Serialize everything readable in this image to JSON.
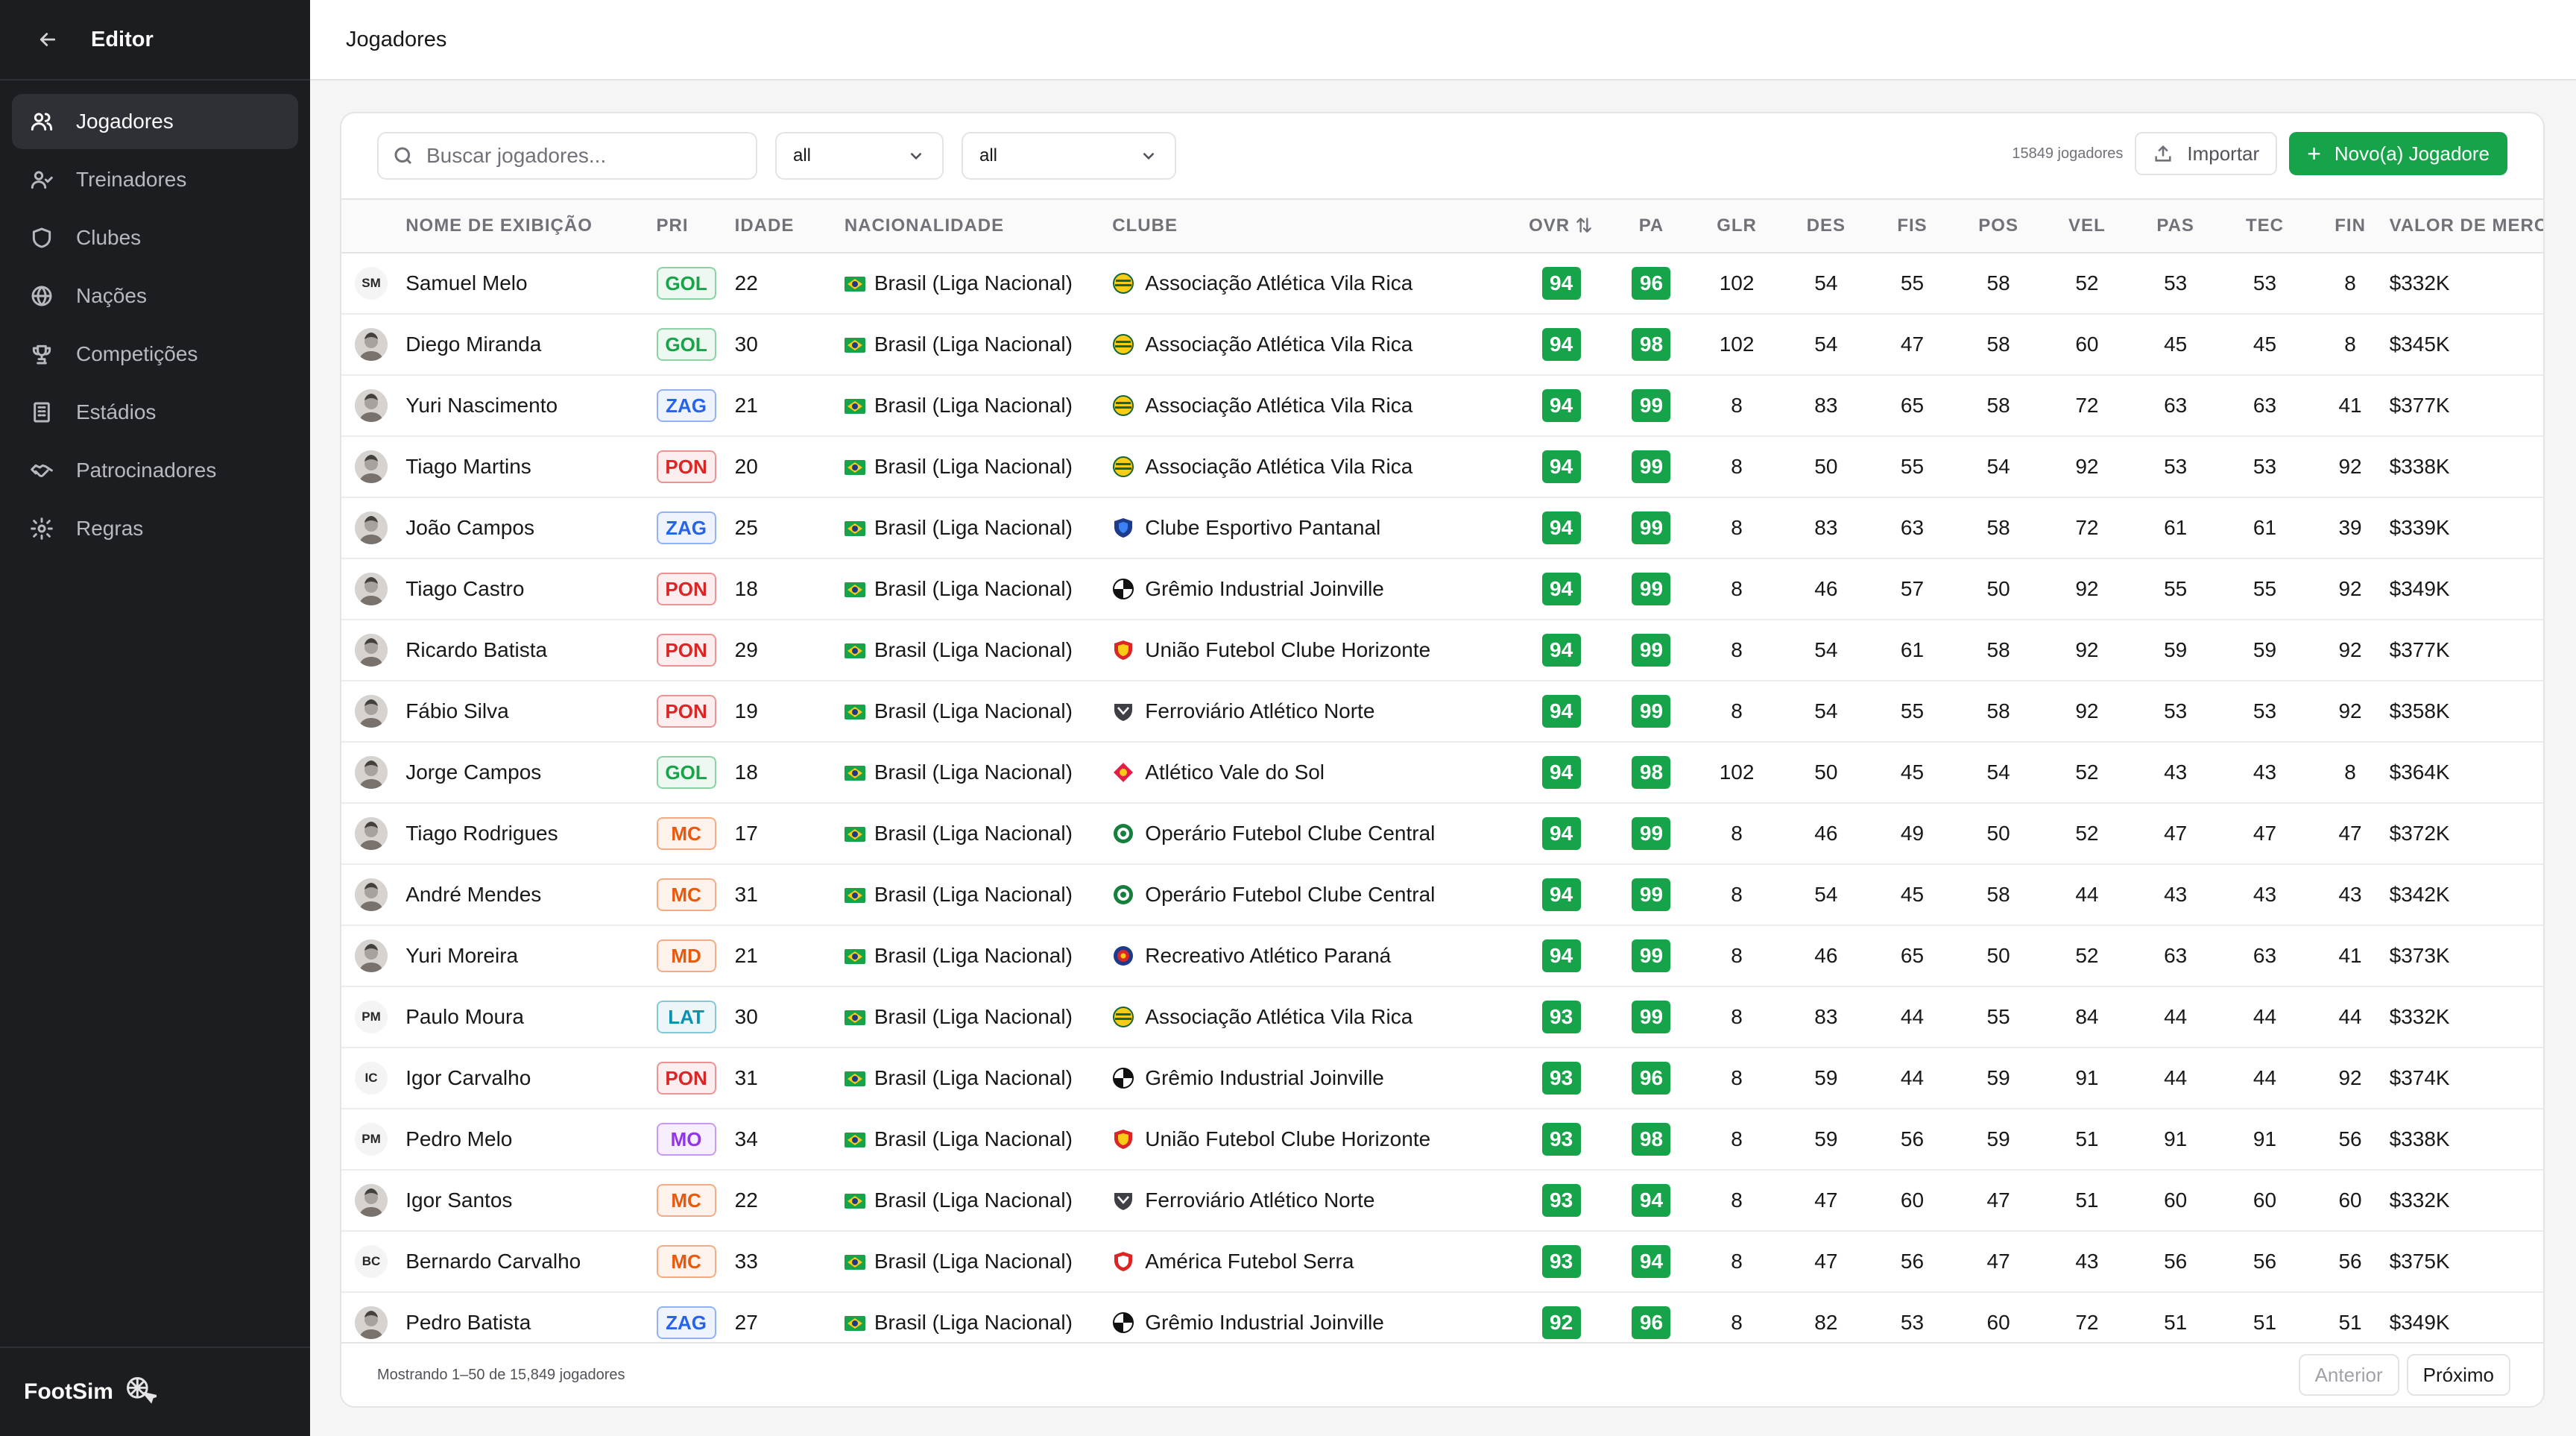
{
  "sidebar": {
    "title": "Editor",
    "nav": [
      {
        "label": "Jogadores",
        "icon": "users-icon",
        "active": true
      },
      {
        "label": "Treinadores",
        "icon": "user-coach-icon",
        "active": false
      },
      {
        "label": "Clubes",
        "icon": "shield-icon",
        "active": false
      },
      {
        "label": "Nações",
        "icon": "globe-icon",
        "active": false
      },
      {
        "label": "Competições",
        "icon": "trophy-icon",
        "active": false
      },
      {
        "label": "Estádios",
        "icon": "building-icon",
        "active": false
      },
      {
        "label": "Patrocinadores",
        "icon": "handshake-icon",
        "active": false
      },
      {
        "label": "Regras",
        "icon": "gear-icon",
        "active": false
      }
    ],
    "brand": "FootSim"
  },
  "header": {
    "title": "Jogadores"
  },
  "toolbar": {
    "search_placeholder": "Buscar jogadores...",
    "filter1": "all",
    "filter2": "all",
    "count": "15849 jogadores",
    "import_label": "Importar",
    "new_label": "Novo(a) Jogadore"
  },
  "table": {
    "columns": [
      "",
      "NOME DE EXIBIÇÃO",
      "PRI",
      "IDADE",
      "NACIONALIDADE",
      "CLUBE",
      "OVR",
      "PA",
      "GLR",
      "DES",
      "FIS",
      "POS",
      "VEL",
      "PAS",
      "TEC",
      "FIN",
      "VALOR DE MERCADO"
    ],
    "rows": [
      {
        "avatar": "SM",
        "photo": false,
        "name": "Samuel Melo",
        "pos": "GOL",
        "age": "22",
        "nat": "Brasil (Liga Nacional)",
        "club": "Associação Atlética Vila Rica",
        "crest": "stripes",
        "ovr": "94",
        "pa": "96",
        "glr": "102",
        "des": "54",
        "fis": "55",
        "posv": "58",
        "vel": "52",
        "pas": "53",
        "tec": "53",
        "fin": "8",
        "value": "$332K"
      },
      {
        "avatar": "",
        "photo": true,
        "name": "Diego Miranda",
        "pos": "GOL",
        "age": "30",
        "nat": "Brasil (Liga Nacional)",
        "club": "Associação Atlética Vila Rica",
        "crest": "stripes",
        "ovr": "94",
        "pa": "98",
        "glr": "102",
        "des": "54",
        "fis": "47",
        "posv": "58",
        "vel": "60",
        "pas": "45",
        "tec": "45",
        "fin": "8",
        "value": "$345K"
      },
      {
        "avatar": "",
        "photo": true,
        "name": "Yuri Nascimento",
        "pos": "ZAG",
        "age": "21",
        "nat": "Brasil (Liga Nacional)",
        "club": "Associação Atlética Vila Rica",
        "crest": "stripes",
        "ovr": "94",
        "pa": "99",
        "glr": "8",
        "des": "83",
        "fis": "65",
        "posv": "58",
        "vel": "72",
        "pas": "63",
        "tec": "63",
        "fin": "41",
        "value": "$377K"
      },
      {
        "avatar": "",
        "photo": true,
        "name": "Tiago Martins",
        "pos": "PON",
        "age": "20",
        "nat": "Brasil (Liga Nacional)",
        "club": "Associação Atlética Vila Rica",
        "crest": "stripes",
        "ovr": "94",
        "pa": "99",
        "glr": "8",
        "des": "50",
        "fis": "55",
        "posv": "54",
        "vel": "92",
        "pas": "53",
        "tec": "53",
        "fin": "92",
        "value": "$338K"
      },
      {
        "avatar": "",
        "photo": true,
        "name": "João Campos",
        "pos": "ZAG",
        "age": "25",
        "nat": "Brasil (Liga Nacional)",
        "club": "Clube Esportivo Pantanal",
        "crest": "blue",
        "ovr": "94",
        "pa": "99",
        "glr": "8",
        "des": "83",
        "fis": "63",
        "posv": "58",
        "vel": "72",
        "pas": "61",
        "tec": "61",
        "fin": "39",
        "value": "$339K"
      },
      {
        "avatar": "",
        "photo": true,
        "name": "Tiago Castro",
        "pos": "PON",
        "age": "18",
        "nat": "Brasil (Liga Nacional)",
        "club": "Grêmio Industrial Joinville",
        "crest": "ball",
        "ovr": "94",
        "pa": "99",
        "glr": "8",
        "des": "46",
        "fis": "57",
        "posv": "50",
        "vel": "92",
        "pas": "55",
        "tec": "55",
        "fin": "92",
        "value": "$349K"
      },
      {
        "avatar": "",
        "photo": true,
        "name": "Ricardo Batista",
        "pos": "PON",
        "age": "29",
        "nat": "Brasil (Liga Nacional)",
        "club": "União Futebol Clube Horizonte",
        "crest": "redyellow",
        "ovr": "94",
        "pa": "99",
        "glr": "8",
        "des": "54",
        "fis": "61",
        "posv": "58",
        "vel": "92",
        "pas": "59",
        "tec": "59",
        "fin": "92",
        "value": "$377K"
      },
      {
        "avatar": "",
        "photo": true,
        "name": "Fábio Silva",
        "pos": "PON",
        "age": "19",
        "nat": "Brasil (Liga Nacional)",
        "club": "Ferroviário Atlético Norte",
        "crest": "dark",
        "ovr": "94",
        "pa": "99",
        "glr": "8",
        "des": "54",
        "fis": "55",
        "posv": "58",
        "vel": "92",
        "pas": "53",
        "tec": "53",
        "fin": "92",
        "value": "$358K"
      },
      {
        "avatar": "",
        "photo": true,
        "name": "Jorge Campos",
        "pos": "GOL",
        "age": "18",
        "nat": "Brasil (Liga Nacional)",
        "club": "Atlético Vale do Sol",
        "crest": "diamond",
        "ovr": "94",
        "pa": "98",
        "glr": "102",
        "des": "50",
        "fis": "45",
        "posv": "54",
        "vel": "52",
        "pas": "43",
        "tec": "43",
        "fin": "8",
        "value": "$364K"
      },
      {
        "avatar": "",
        "photo": true,
        "name": "Tiago Rodrigues",
        "pos": "MC",
        "age": "17",
        "nat": "Brasil (Liga Nacional)",
        "club": "Operário Futebol Clube Central",
        "crest": "green",
        "ovr": "94",
        "pa": "99",
        "glr": "8",
        "des": "46",
        "fis": "49",
        "posv": "50",
        "vel": "52",
        "pas": "47",
        "tec": "47",
        "fin": "47",
        "value": "$372K"
      },
      {
        "avatar": "",
        "photo": true,
        "name": "André Mendes",
        "pos": "MC",
        "age": "31",
        "nat": "Brasil (Liga Nacional)",
        "club": "Operário Futebol Clube Central",
        "crest": "green",
        "ovr": "94",
        "pa": "99",
        "glr": "8",
        "des": "54",
        "fis": "45",
        "posv": "58",
        "vel": "44",
        "pas": "43",
        "tec": "43",
        "fin": "43",
        "value": "$342K"
      },
      {
        "avatar": "",
        "photo": true,
        "name": "Yuri Moreira",
        "pos": "MD",
        "age": "21",
        "nat": "Brasil (Liga Nacional)",
        "club": "Recreativo Atlético Paraná",
        "crest": "target",
        "ovr": "94",
        "pa": "99",
        "glr": "8",
        "des": "46",
        "fis": "65",
        "posv": "50",
        "vel": "52",
        "pas": "63",
        "tec": "63",
        "fin": "41",
        "value": "$373K"
      },
      {
        "avatar": "PM",
        "photo": false,
        "name": "Paulo Moura",
        "pos": "LAT",
        "age": "30",
        "nat": "Brasil (Liga Nacional)",
        "club": "Associação Atlética Vila Rica",
        "crest": "stripes",
        "ovr": "93",
        "pa": "99",
        "glr": "8",
        "des": "83",
        "fis": "44",
        "posv": "55",
        "vel": "84",
        "pas": "44",
        "tec": "44",
        "fin": "44",
        "value": "$332K"
      },
      {
        "avatar": "IC",
        "photo": false,
        "name": "Igor Carvalho",
        "pos": "PON",
        "age": "31",
        "nat": "Brasil (Liga Nacional)",
        "club": "Grêmio Industrial Joinville",
        "crest": "ball",
        "ovr": "93",
        "pa": "96",
        "glr": "8",
        "des": "59",
        "fis": "44",
        "posv": "59",
        "vel": "91",
        "pas": "44",
        "tec": "44",
        "fin": "92",
        "value": "$374K"
      },
      {
        "avatar": "PM",
        "photo": false,
        "name": "Pedro Melo",
        "pos": "MO",
        "age": "34",
        "nat": "Brasil (Liga Nacional)",
        "club": "União Futebol Clube Horizonte",
        "crest": "redyellow",
        "ovr": "93",
        "pa": "98",
        "glr": "8",
        "des": "59",
        "fis": "56",
        "posv": "59",
        "vel": "51",
        "pas": "91",
        "tec": "91",
        "fin": "56",
        "value": "$338K"
      },
      {
        "avatar": "",
        "photo": true,
        "name": "Igor Santos",
        "pos": "MC",
        "age": "22",
        "nat": "Brasil (Liga Nacional)",
        "club": "Ferroviário Atlético Norte",
        "crest": "dark",
        "ovr": "93",
        "pa": "94",
        "glr": "8",
        "des": "47",
        "fis": "60",
        "posv": "47",
        "vel": "51",
        "pas": "60",
        "tec": "60",
        "fin": "60",
        "value": "$332K"
      },
      {
        "avatar": "BC",
        "photo": false,
        "name": "Bernardo Carvalho",
        "pos": "MC",
        "age": "33",
        "nat": "Brasil (Liga Nacional)",
        "club": "América Futebol Serra",
        "crest": "redshield",
        "ovr": "93",
        "pa": "94",
        "glr": "8",
        "des": "47",
        "fis": "56",
        "posv": "47",
        "vel": "43",
        "pas": "56",
        "tec": "56",
        "fin": "56",
        "value": "$375K"
      },
      {
        "avatar": "",
        "photo": true,
        "name": "Pedro Batista",
        "pos": "ZAG",
        "age": "27",
        "nat": "Brasil (Liga Nacional)",
        "club": "Grêmio Industrial Joinville",
        "crest": "ball",
        "ovr": "92",
        "pa": "96",
        "glr": "8",
        "des": "82",
        "fis": "53",
        "posv": "60",
        "vel": "72",
        "pas": "51",
        "tec": "51",
        "fin": "51",
        "value": "$349K"
      }
    ]
  },
  "footer": {
    "info": "Mostrando 1–50 de 15,849 jogadores",
    "prev": "Anterior",
    "next": "Próximo"
  },
  "colors": {
    "accent": "#16a34a",
    "sidebar_bg": "#1c1d21",
    "pos_GOL": "#16a34a",
    "pos_ZAG": "#2563eb",
    "pos_LAT": "#0891b2",
    "pos_PON": "#dc2626",
    "pos_MC": "#ea580c",
    "pos_MD": "#ea580c",
    "pos_MO": "#9333ea"
  }
}
